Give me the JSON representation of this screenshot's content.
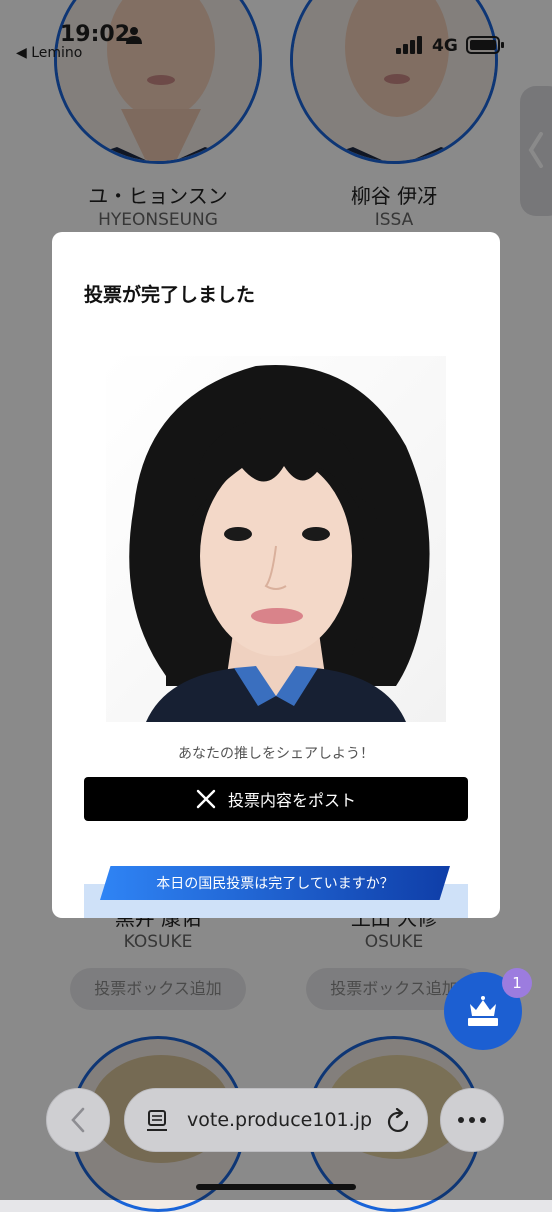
{
  "status_bar": {
    "time": "19:02",
    "back_app": "◀ Lemino",
    "network": "4G"
  },
  "background": {
    "trainees": [
      {
        "name": "ユ・ヒョンスン",
        "roman": "HYEONSEUNG"
      },
      {
        "name": "柳谷 伊冴",
        "roman": "ISSA"
      },
      {
        "name": "黒井 康佑",
        "roman": "KOSUKE"
      },
      {
        "name": "土田 大修",
        "roman": "OSUKE"
      }
    ],
    "add_box_label": "投票ボックス追加",
    "fab_badge": "1"
  },
  "modal": {
    "title": "投票が完了しました",
    "share_prompt": "あなたの推しをシェアしよう！",
    "post_button": "投票内容をポスト",
    "banner": "本日の国民投票は完了していますか？"
  },
  "browser": {
    "url": "vote.produce101.jp"
  }
}
